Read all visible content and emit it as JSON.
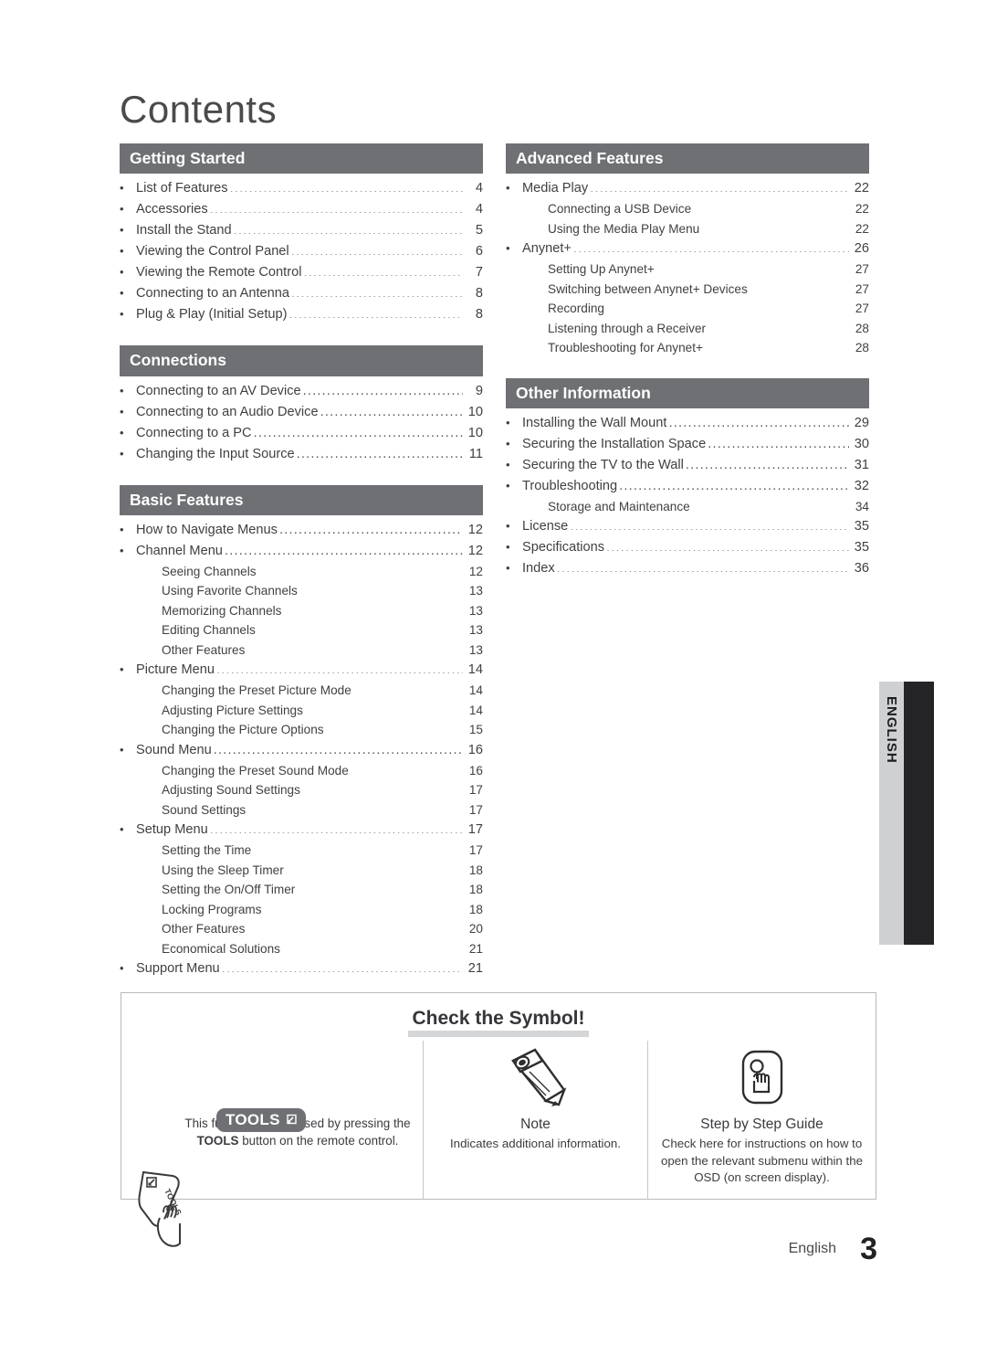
{
  "page_title": "Contents",
  "colors": {
    "section_bar": "#6e7074",
    "tab_gray": "#cfd0d2",
    "tab_black": "#252527",
    "highlight": "#d4d6d8",
    "text": "#3a3a3c"
  },
  "side_tab": {
    "label": "ENGLISH"
  },
  "footer": {
    "language": "English",
    "page_number": "3"
  },
  "columns": {
    "left": [
      {
        "title": "Getting Started",
        "entries": [
          {
            "level": 1,
            "label": "List of Features",
            "page": "4"
          },
          {
            "level": 1,
            "label": "Accessories",
            "page": "4"
          },
          {
            "level": 1,
            "label": "Install the Stand",
            "page": "5"
          },
          {
            "level": 1,
            "label": "Viewing the Control Panel",
            "page": "6"
          },
          {
            "level": 1,
            "label": "Viewing the Remote Control",
            "page": "7"
          },
          {
            "level": 1,
            "label": "Connecting to an Antenna",
            "page": "8"
          },
          {
            "level": 1,
            "label": "Plug & Play (Initial Setup)",
            "page": "8"
          }
        ]
      },
      {
        "title": "Connections",
        "entries": [
          {
            "level": 1,
            "label": "Connecting to an AV Device",
            "page": "9"
          },
          {
            "level": 1,
            "label": "Connecting to an Audio Device",
            "page": "10"
          },
          {
            "level": 1,
            "label": "Connecting to a PC",
            "page": "10"
          },
          {
            "level": 1,
            "label": "Changing the Input Source",
            "page": "11"
          }
        ]
      },
      {
        "title": "Basic Features",
        "entries": [
          {
            "level": 1,
            "label": "How to Navigate Menus",
            "page": "12"
          },
          {
            "level": 1,
            "label": "Channel Menu",
            "page": "12"
          },
          {
            "level": 2,
            "label": "Seeing Channels",
            "page": "12"
          },
          {
            "level": 2,
            "label": "Using Favorite Channels",
            "page": "13"
          },
          {
            "level": 2,
            "label": "Memorizing Channels",
            "page": "13"
          },
          {
            "level": 2,
            "label": "Editing Channels",
            "page": "13"
          },
          {
            "level": 2,
            "label": "Other Features",
            "page": "13"
          },
          {
            "level": 1,
            "label": "Picture Menu",
            "page": "14"
          },
          {
            "level": 2,
            "label": "Changing the Preset Picture Mode",
            "page": "14"
          },
          {
            "level": 2,
            "label": "Adjusting Picture Settings",
            "page": "14"
          },
          {
            "level": 2,
            "label": "Changing the Picture Options",
            "page": "15"
          },
          {
            "level": 1,
            "label": "Sound Menu",
            "page": "16"
          },
          {
            "level": 2,
            "label": "Changing the Preset Sound Mode",
            "page": "16"
          },
          {
            "level": 2,
            "label": "Adjusting Sound Settings",
            "page": "17"
          },
          {
            "level": 2,
            "label": "Sound Settings",
            "page": "17"
          },
          {
            "level": 1,
            "label": "Setup Menu",
            "page": "17"
          },
          {
            "level": 2,
            "label": "Setting the Time",
            "page": "17"
          },
          {
            "level": 2,
            "label": "Using the Sleep Timer",
            "page": "18"
          },
          {
            "level": 2,
            "label": "Setting the On/Off Timer",
            "page": "18"
          },
          {
            "level": 2,
            "label": "Locking Programs",
            "page": "18"
          },
          {
            "level": 2,
            "label": "Other Features",
            "page": "20"
          },
          {
            "level": 2,
            "label": "Economical Solutions",
            "page": "21"
          },
          {
            "level": 1,
            "label": "Support Menu",
            "page": "21"
          }
        ]
      }
    ],
    "right": [
      {
        "title": "Advanced Features",
        "entries": [
          {
            "level": 1,
            "label": "Media Play",
            "page": "22"
          },
          {
            "level": 2,
            "label": "Connecting a USB Device",
            "page": "22"
          },
          {
            "level": 2,
            "label": "Using the Media Play Menu",
            "page": "22"
          },
          {
            "level": 1,
            "label": "Anynet+",
            "page": "26"
          },
          {
            "level": 2,
            "label": "Setting Up Anynet+",
            "page": "27"
          },
          {
            "level": 2,
            "label": "Switching between Anynet+ Devices",
            "page": "27"
          },
          {
            "level": 2,
            "label": "Recording",
            "page": "27"
          },
          {
            "level": 2,
            "label": "Listening through a Receiver",
            "page": "28"
          },
          {
            "level": 2,
            "label": "Troubleshooting for Anynet+",
            "page": "28"
          }
        ]
      },
      {
        "title": "Other Information",
        "entries": [
          {
            "level": 1,
            "label": "Installing the Wall Mount",
            "page": "29"
          },
          {
            "level": 1,
            "label": "Securing the Installation Space",
            "page": "30"
          },
          {
            "level": 1,
            "label": "Securing the TV to the Wall",
            "page": "31"
          },
          {
            "level": 1,
            "label": "Troubleshooting",
            "page": "32"
          },
          {
            "level": 2,
            "label": "Storage and Maintenance",
            "page": "34"
          },
          {
            "level": 1,
            "label": "License",
            "page": "35"
          },
          {
            "level": 1,
            "label": "Specifications",
            "page": "35"
          },
          {
            "level": 1,
            "label": "Index",
            "page": "36"
          }
        ]
      }
    ]
  },
  "symbol_box": {
    "title": "Check the Symbol!",
    "items": [
      {
        "icon": "tools-badge-icon",
        "badge_label": "TOOLS",
        "heading": "",
        "body": "This function can be used by pressing the TOOLS button on the remote control.",
        "body_line1": "This function can be used by pressing the",
        "body_line2_bold": "TOOLS",
        "body_line2_rest": " button on the remote control."
      },
      {
        "icon": "pencil-icon",
        "heading": "Note",
        "body": "Indicates additional information."
      },
      {
        "icon": "step-guide-hand-icon",
        "heading": "Step by Step Guide",
        "body": "Check here for instructions on how to open the relevant submenu within the OSD (on screen display)."
      }
    ]
  }
}
